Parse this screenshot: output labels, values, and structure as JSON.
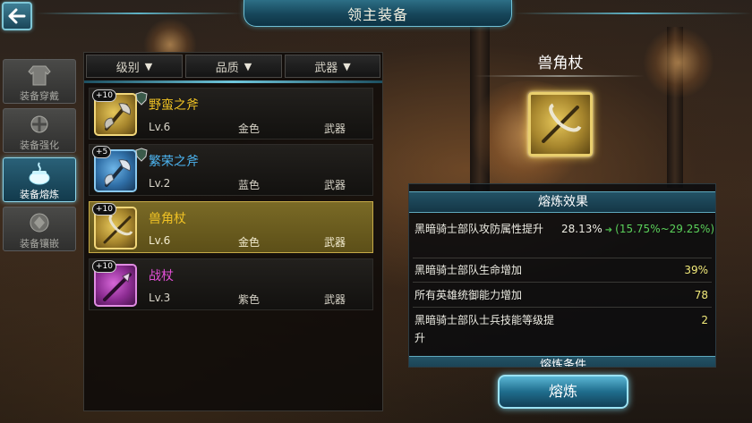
{
  "header": {
    "title": "领主装备",
    "back_icon": "back-arrow-icon"
  },
  "nav": {
    "items": [
      {
        "label": "装备穿戴",
        "icon": "armor-icon",
        "active": false
      },
      {
        "label": "装备强化",
        "icon": "upgrade-icon",
        "active": false
      },
      {
        "label": "装备熔炼",
        "icon": "smelt-pot-icon",
        "active": true
      },
      {
        "label": "装备镶嵌",
        "icon": "gem-socket-icon",
        "active": false
      }
    ]
  },
  "filters": {
    "level": "级别",
    "quality": "品质",
    "type": "武器"
  },
  "items": [
    {
      "plus": "+10",
      "name": "野蛮之斧",
      "level": "Lv.6",
      "quality": "金色",
      "type": "武器",
      "rarity": "gold",
      "icon": "axe-icon",
      "selected": false
    },
    {
      "plus": "+5",
      "name": "繁荣之斧",
      "level": "Lv.2",
      "quality": "蓝色",
      "type": "武器",
      "rarity": "blue",
      "icon": "axe-icon",
      "selected": false
    },
    {
      "plus": "+10",
      "name": "兽角杖",
      "level": "Lv.6",
      "quality": "金色",
      "type": "武器",
      "rarity": "gold",
      "icon": "horn-staff-icon",
      "selected": true
    },
    {
      "plus": "+10",
      "name": "战杖",
      "level": "Lv.3",
      "quality": "紫色",
      "type": "武器",
      "rarity": "purple",
      "icon": "war-staff-icon",
      "selected": false
    }
  ],
  "detail": {
    "name": "兽角杖",
    "icon": "horn-staff-icon",
    "effects_title": "熔炼效果",
    "stats": [
      {
        "label": "黑暗骑士部队攻防属性提升",
        "value": "28.13%",
        "next": "(15.75%~29.25%)"
      },
      {
        "label": "黑暗骑士部队生命增加",
        "value": "39%"
      },
      {
        "label": "所有英雄统御能力增加",
        "value": "78"
      },
      {
        "label": "黑暗骑士部队士兵技能等级提升",
        "value": "2"
      }
    ],
    "conditions_title": "熔炼条件"
  },
  "smelt_button": "熔炼",
  "colors": {
    "gold": "#f0c224",
    "blue": "#4cb4f0",
    "purple": "#e24fd6",
    "accent": "#6fc6db",
    "value": "#f2ea7a",
    "next": "#5ad05a"
  }
}
